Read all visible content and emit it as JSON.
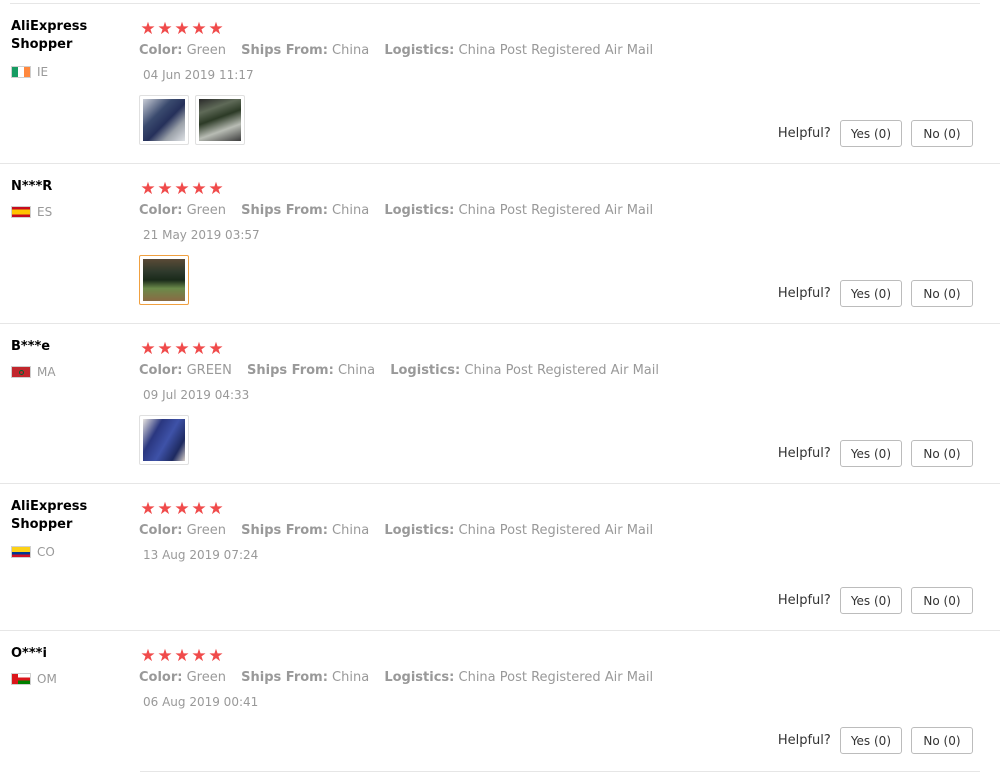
{
  "helpful_label": "Helpful?",
  "colors": {
    "star": "#f04b4b",
    "muted_text": "#999999",
    "divider": "#e6e6e6"
  },
  "reviews": [
    {
      "user": "AliExpress Shopper",
      "country": "IE",
      "flag": "ireland-flag-icon",
      "rating": 5,
      "color_label": "Color:",
      "color_value": "Green",
      "ships_label": "Ships From:",
      "ships_value": "China",
      "logistics_label": "Logistics:",
      "logistics_value": "China Post Registered Air Mail",
      "date": "04 Jun 2019 11:17",
      "photos": 2,
      "yes": "Yes (0)",
      "no": "No (0)"
    },
    {
      "user": "N***R",
      "country": "ES",
      "flag": "spain-flag-icon",
      "rating": 5,
      "color_label": "Color:",
      "color_value": "Green",
      "ships_label": "Ships From:",
      "ships_value": "China",
      "logistics_label": "Logistics:",
      "logistics_value": "China Post Registered Air Mail",
      "date": "21 May 2019 03:57",
      "photos": 1,
      "yes": "Yes (0)",
      "no": "No (0)"
    },
    {
      "user": "B***e",
      "country": "MA",
      "flag": "morocco-flag-icon",
      "rating": 5,
      "color_label": "Color:",
      "color_value": "GREEN",
      "ships_label": "Ships From:",
      "ships_value": "China",
      "logistics_label": "Logistics:",
      "logistics_value": "China Post Registered Air Mail",
      "date": "09 Jul 2019 04:33",
      "photos": 1,
      "yes": "Yes (0)",
      "no": "No (0)"
    },
    {
      "user": "AliExpress Shopper",
      "country": "CO",
      "flag": "colombia-flag-icon",
      "rating": 5,
      "color_label": "Color:",
      "color_value": "Green",
      "ships_label": "Ships From:",
      "ships_value": "China",
      "logistics_label": "Logistics:",
      "logistics_value": "China Post Registered Air Mail",
      "date": "13 Aug 2019 07:24",
      "photos": 0,
      "yes": "Yes (0)",
      "no": "No (0)"
    },
    {
      "user": "O***i",
      "country": "OM",
      "flag": "oman-flag-icon",
      "rating": 5,
      "color_label": "Color:",
      "color_value": "Green",
      "ships_label": "Ships From:",
      "ships_value": "China",
      "logistics_label": "Logistics:",
      "logistics_value": "China Post Registered Air Mail",
      "date": "06 Aug 2019 00:41",
      "photos": 0,
      "yes": "Yes (0)",
      "no": "No (0)"
    }
  ]
}
